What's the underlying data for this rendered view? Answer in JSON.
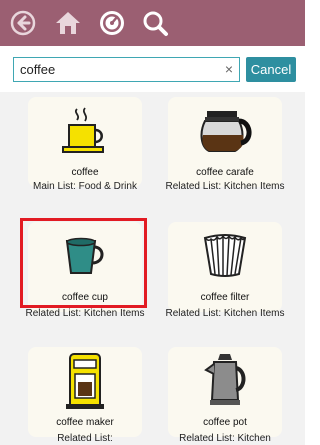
{
  "search": {
    "value": "coffee",
    "clear_glyph": "×"
  },
  "cancel_label": "Cancel",
  "toolbar_icons": [
    "back-arrow-icon",
    "home-icon",
    "dashboard-icon",
    "search-icon"
  ],
  "results": [
    {
      "label": "coffee",
      "sub": "Main List: Food & Drink",
      "icon": "coffee-mug-icon"
    },
    {
      "label": "coffee carafe",
      "sub": "Related List: Kitchen Items",
      "icon": "coffee-carafe-icon"
    },
    {
      "label": "coffee cup",
      "sub": "Related List: Kitchen Items",
      "icon": "coffee-cup-icon",
      "selected": true
    },
    {
      "label": "coffee filter",
      "sub": "Related List: Kitchen Items",
      "icon": "coffee-filter-icon"
    },
    {
      "label": "coffee maker",
      "sub": "Related List:",
      "icon": "coffee-maker-icon"
    },
    {
      "label": "coffee pot",
      "sub": "Related List: Kitchen",
      "icon": "coffee-pot-icon"
    }
  ]
}
